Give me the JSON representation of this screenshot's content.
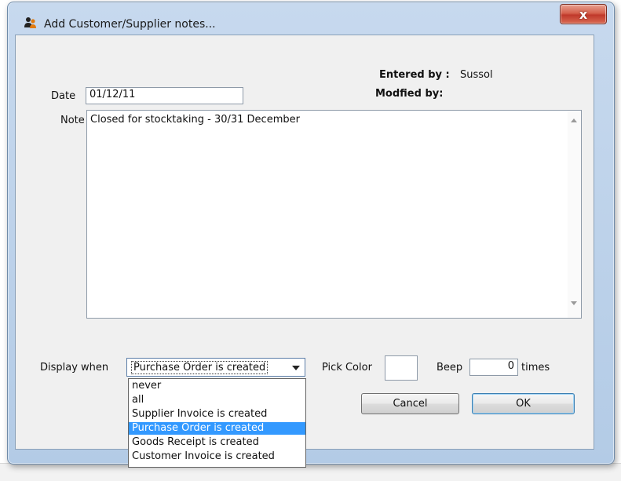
{
  "window": {
    "title": "Add Customer/Supplier notes...",
    "close_glyph": "x"
  },
  "form": {
    "entered_by_label": "Entered by :",
    "entered_by_value": "Sussol",
    "modified_by_label": "Modfied by:",
    "modified_by_value": "",
    "date_label": "Date",
    "date_value": "01/12/11",
    "note_label": "Note",
    "note_value": "Closed for stocktaking - 30/31 December"
  },
  "display_when": {
    "label": "Display when",
    "selected": "Purchase Order is created",
    "options": [
      "never",
      "all",
      "Supplier Invoice is created",
      "Purchase Order is created",
      "Goods Receipt is created",
      "Customer Invoice is created"
    ]
  },
  "pick_color": {
    "label": "Pick Color",
    "value_color": "#ffffff"
  },
  "beep": {
    "label": "Beep",
    "value": "0",
    "unit": "times"
  },
  "buttons": {
    "cancel": "Cancel",
    "ok": "OK"
  },
  "icons": {
    "app": "users-icon",
    "close": "close-icon",
    "dropdown": "chevron-down-icon",
    "scroll_up": "scroll-up-icon",
    "scroll_down": "scroll-down-icon"
  },
  "colors": {
    "selection": "#3399ff",
    "close_button": "#c0392b",
    "window_frame": "#b3cbe6"
  }
}
